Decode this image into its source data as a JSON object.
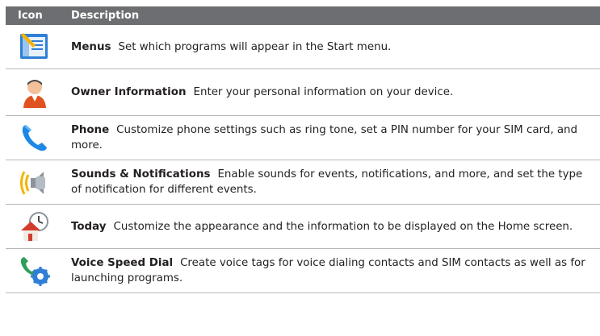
{
  "header": {
    "icon_col": "Icon",
    "desc_col": "Description"
  },
  "rows": [
    {
      "title": "Menus",
      "text": "Set which programs will appear in the Start menu.",
      "icon": "menus-icon"
    },
    {
      "title": "Owner Information",
      "text": "Enter your personal information on your device.",
      "icon": "owner-icon"
    },
    {
      "title": "Phone",
      "text": "Customize phone settings such as ring tone, set a PIN number for your SIM card, and more.",
      "icon": "phone-icon"
    },
    {
      "title": "Sounds & Notifications",
      "text": "Enable sounds for events, notifications, and more, and set the type of notification for different events.",
      "icon": "sound-icon"
    },
    {
      "title": "Today",
      "text": "Customize the appearance and the information to be displayed on the Home screen.",
      "icon": "today-icon"
    },
    {
      "title": "Voice Speed Dial",
      "text": "Create voice tags for voice dialing contacts and SIM contacts as well as for launching programs.",
      "icon": "voice-dial-icon"
    }
  ],
  "colors": {
    "header_bg": "#6d6e71",
    "rule": "#b5b7ba"
  }
}
